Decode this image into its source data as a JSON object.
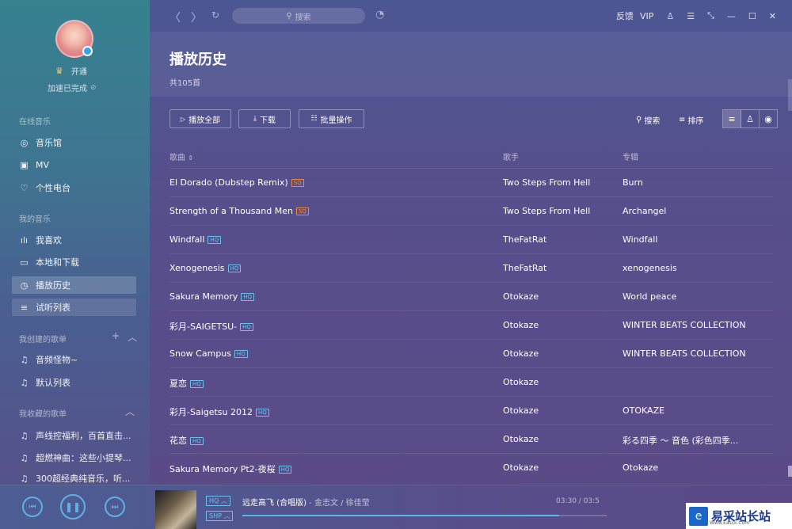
{
  "sidebar": {
    "vip_label": "开通",
    "accel_label": "加速已完成",
    "sections": {
      "online": "在线音乐",
      "mine": "我的音乐",
      "created": "我创建的歌单",
      "collected": "我收藏的歌单"
    },
    "online_items": [
      {
        "label": "音乐馆",
        "icon": "music-hall-icon"
      },
      {
        "label": "MV",
        "icon": "mv-icon"
      },
      {
        "label": "个性电台",
        "icon": "radio-heart-icon"
      }
    ],
    "my_items": [
      {
        "label": "我喜欢",
        "icon": "like-bars-icon"
      },
      {
        "label": "本地和下载",
        "icon": "monitor-icon"
      },
      {
        "label": "播放历史",
        "icon": "clock-icon",
        "active": true
      },
      {
        "label": "试听列表",
        "icon": "playlist-icon"
      }
    ],
    "created_items": [
      {
        "label": "音频怪物~",
        "icon": "music-note-icon"
      },
      {
        "label": "默认列表",
        "icon": "music-note-icon"
      }
    ],
    "collected_items": [
      {
        "label": "声线控福利，百首直击...",
        "icon": "music-note-icon"
      },
      {
        "label": "超燃神曲：这些小提琴...",
        "icon": "music-note-icon"
      },
      {
        "label": "300超经典纯音乐，听...",
        "icon": "music-note-icon"
      }
    ]
  },
  "titlebar": {
    "search_placeholder": "搜索",
    "feedback": "反馈",
    "vip": "VIP"
  },
  "page": {
    "title": "播放历史",
    "count": "共105首"
  },
  "toolbar": {
    "play_all": "播放全部",
    "download": "下载",
    "batch": "批量操作",
    "search": "搜索",
    "sort": "排序"
  },
  "columns": {
    "song": "歌曲",
    "artist": "歌手",
    "album": "专辑"
  },
  "songs": [
    {
      "title": "El Dorado (Dubstep Remix)",
      "quality": "SQ",
      "artist": "Two Steps From Hell",
      "album": "Burn"
    },
    {
      "title": "Strength of a Thousand Men",
      "quality": "SQ",
      "artist": "Two Steps From Hell",
      "album": "Archangel"
    },
    {
      "title": "Windfall",
      "quality": "HQ",
      "artist": "TheFatRat",
      "album": "Windfall"
    },
    {
      "title": "Xenogenesis",
      "quality": "HQ",
      "artist": "TheFatRat",
      "album": "xenogenesis"
    },
    {
      "title": "Sakura Memory",
      "quality": "HQ",
      "artist": "Otokaze",
      "album": "World peace"
    },
    {
      "title": "彩月-SAIGETSU-",
      "quality": "HQ",
      "artist": "Otokaze",
      "album": "WINTER BEATS COLLECTION"
    },
    {
      "title": "Snow Campus",
      "quality": "HQ",
      "artist": "Otokaze",
      "album": "WINTER BEATS COLLECTION"
    },
    {
      "title": "夏恋",
      "quality": "HQ",
      "artist": "Otokaze",
      "album": ""
    },
    {
      "title": "彩月-Saigetsu 2012",
      "quality": "HQ",
      "artist": "Otokaze",
      "album": "OTOKAZE"
    },
    {
      "title": "花恋",
      "quality": "HQ",
      "artist": "Otokaze",
      "album": "彩る四季 ～ 音色 (彩色四季..."
    },
    {
      "title": "Sakura Memory Pt2-夜桜",
      "quality": "HQ",
      "artist": "Otokaze",
      "album": "Otokaze"
    }
  ],
  "player": {
    "quality_hq": "HQ",
    "quality_shp": "SHP",
    "title": "远走高飞 (合唱版)",
    "artist": " - 金志文 / 徐佳莹",
    "time": "03:30 / 03:5",
    "progress": 0.87
  },
  "watermark": {
    "text": "易采站长站",
    "sub": "Www.Easck.Com"
  },
  "colors": {
    "accent": "#58b6ec",
    "sq_tag": "#f08a3c",
    "hq_tag": "#6cc0f0"
  }
}
